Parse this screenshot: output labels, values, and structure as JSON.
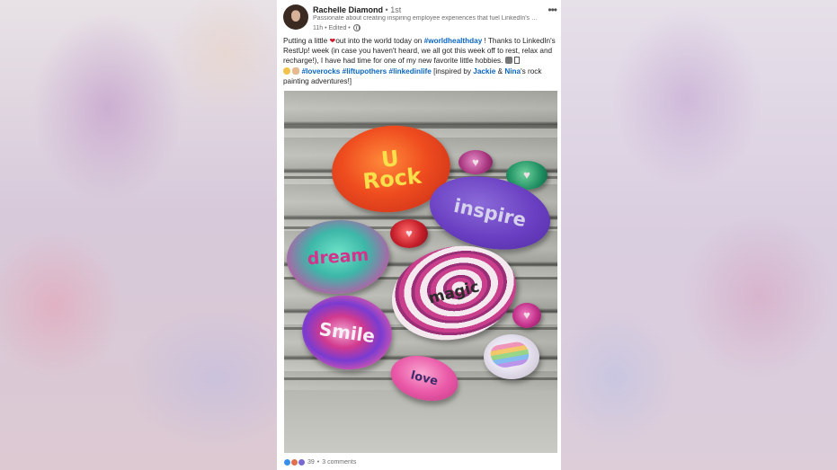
{
  "post": {
    "author": {
      "name": "Rachelle Diamond",
      "degree": "• 1st",
      "headline": "Passionate about creating inspiring employee experiences that fuel LinkedIn's c...",
      "time": "11h • Edited •"
    },
    "text": {
      "line1_a": "Putting a little ",
      "line1_b": "out into the world today on ",
      "hashtag_worldhealthday": "#worldhealthday",
      "line1_c": " ! Thanks to LinkedIn's RestUp! week (in case you haven't heard, we all got this week off to rest, relax and recharge!), I have had time for one of my new favorite little hobbies.",
      "hashtag_loverocks": "#loverocks",
      "hashtag_liftupothers": "#liftupothers",
      "hashtag_linkedinlife": "#linkedinlife",
      "line2_a": " [inspired by ",
      "mention_jackie": "Jackie",
      "line2_b": " & ",
      "mention_nina": "Nina",
      "line2_c": "'s rock painting adventures!]"
    },
    "image": {
      "rock_labels": {
        "u_rock_1": "U",
        "u_rock_2": "Rock",
        "inspire": "inspire",
        "dream": "dream",
        "magic": "magic",
        "smile": "Smile",
        "love": "love"
      }
    },
    "social": {
      "reaction_count": "39",
      "dot": "•",
      "comments": "3 comments"
    }
  },
  "colors": {
    "link": "#0a66c2",
    "heart": "#d11a2a",
    "text": "#1f1f1f",
    "muted": "#6d6d6d"
  },
  "icons": {
    "more": "more-horizontal-icon",
    "visibility": "globe-icon",
    "reactions": [
      "like-icon",
      "love-icon",
      "insightful-icon"
    ]
  }
}
